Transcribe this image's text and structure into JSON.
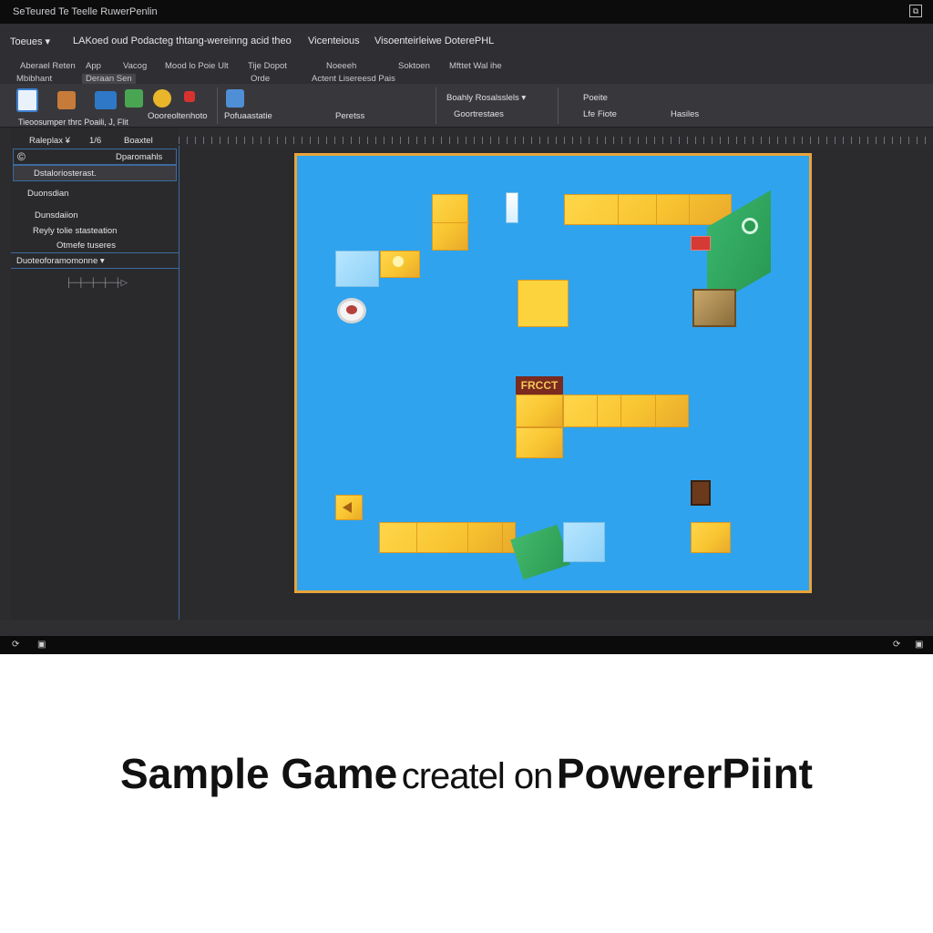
{
  "window": {
    "title": "SeTeured Te Teelle RuwerPenlin",
    "control_glyph": "⧉"
  },
  "menubar": {
    "items": [
      "Toeues  ▾",
      "LAKoed oud Podacteg thtang-wereinng acid theo",
      "Vicenteious",
      "Visoenteirleiwe DoterePHL"
    ]
  },
  "tabs": {
    "row1": [
      "Aberael Reten",
      "App",
      "Vacog",
      "Mood  lo  Poie  Ult",
      "Tije  Dopot",
      "Noeeeh",
      "Soktoen",
      "Mfttet  Wal ihe"
    ],
    "row2": [
      "Mbibhant",
      "Deraan Sen",
      "Orde",
      "Actent Lisereesd Pais"
    ]
  },
  "ribbon": {
    "groups": [
      "Oooreoltenhoto",
      "Pofuaastatie",
      "Boahly Rasalsslelis",
      "Peretss",
      "Goortrestaes",
      "Lfe Fiote",
      "Hasiles"
    ],
    "small_labels": [
      "Tieoosumper thrc Poaili,  J,  Flit",
      "Boahly Rosalsslels  ▾",
      "Poeite"
    ]
  },
  "left_panel": {
    "header": [
      "Raleplax  ¥",
      "1/6",
      "Boaxtel"
    ],
    "dropdown_value": "Dparomahls",
    "items": [
      "Dstaloriosterast.",
      "Duonsdian",
      "Dunsdaiion",
      "Reyly tolie stasteation",
      "Otmefe tuseres"
    ],
    "field_value": "Duoteoforamomonne  ▾",
    "scrubber": "├─┼─┼─┼─┼▷"
  },
  "slide": {
    "frame_color": "#e7a43b",
    "background_color": "#2fa3ee",
    "tile_color": "#f8c531",
    "sign_text": "FRCCT"
  },
  "status": {
    "left_icons": [
      "⟳",
      "▣"
    ],
    "right_icons": [
      "⟳",
      "▣"
    ]
  },
  "caption": {
    "part1": "Sample Game",
    "part2": "createl on",
    "part3": "PowererPiint"
  }
}
